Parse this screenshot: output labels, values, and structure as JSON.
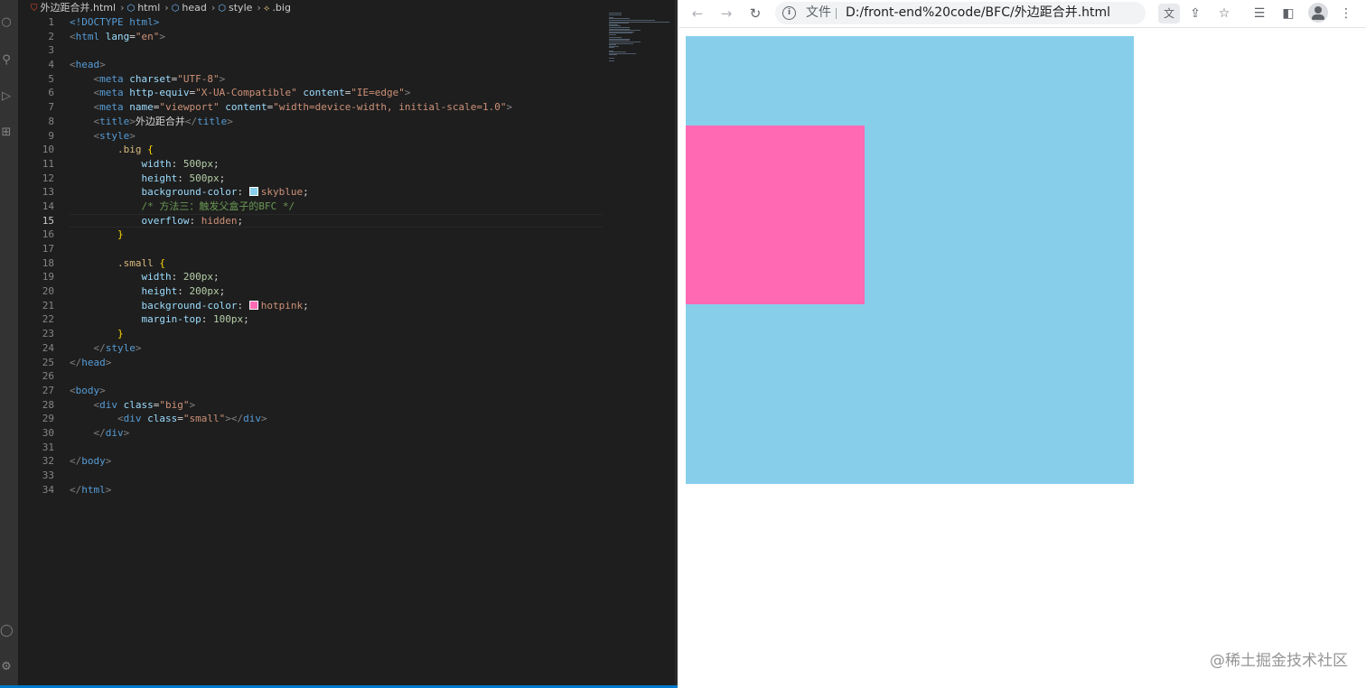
{
  "editor": {
    "breadcrumb": [
      {
        "label": "外边距合并.html",
        "icon": "html5-file-icon",
        "glyph": "⛉"
      },
      {
        "label": "html",
        "icon": "cube-icon",
        "glyph": "⬡"
      },
      {
        "label": "head",
        "icon": "cube-icon",
        "glyph": "⬡"
      },
      {
        "label": "style",
        "icon": "cube-icon",
        "glyph": "⬡"
      },
      {
        "label": ".big",
        "icon": "selector-icon",
        "glyph": "⟡"
      }
    ],
    "active_line": 15,
    "lines": [
      [
        [
          "t-doctype",
          "<!DOCTYPE html>"
        ]
      ],
      [
        [
          "t-bracket",
          "<"
        ],
        [
          "t-tag",
          "html"
        ],
        [
          "t-text",
          " "
        ],
        [
          "t-attr",
          "lang"
        ],
        [
          "t-text",
          "="
        ],
        [
          "t-str",
          "\"en\""
        ],
        [
          "t-bracket",
          ">"
        ]
      ],
      [],
      [
        [
          "t-bracket",
          "<"
        ],
        [
          "t-tag",
          "head"
        ],
        [
          "t-bracket",
          ">"
        ]
      ],
      [
        [
          "t-text",
          "    "
        ],
        [
          "t-bracket",
          "<"
        ],
        [
          "t-tag",
          "meta"
        ],
        [
          "t-text",
          " "
        ],
        [
          "t-attr",
          "charset"
        ],
        [
          "t-text",
          "="
        ],
        [
          "t-str",
          "\"UTF-8\""
        ],
        [
          "t-bracket",
          ">"
        ]
      ],
      [
        [
          "t-text",
          "    "
        ],
        [
          "t-bracket",
          "<"
        ],
        [
          "t-tag",
          "meta"
        ],
        [
          "t-text",
          " "
        ],
        [
          "t-attr",
          "http-equiv"
        ],
        [
          "t-text",
          "="
        ],
        [
          "t-str",
          "\"X-UA-Compatible\""
        ],
        [
          "t-text",
          " "
        ],
        [
          "t-attr",
          "content"
        ],
        [
          "t-text",
          "="
        ],
        [
          "t-str",
          "\"IE=edge\""
        ],
        [
          "t-bracket",
          ">"
        ]
      ],
      [
        [
          "t-text",
          "    "
        ],
        [
          "t-bracket",
          "<"
        ],
        [
          "t-tag",
          "meta"
        ],
        [
          "t-text",
          " "
        ],
        [
          "t-attr",
          "name"
        ],
        [
          "t-text",
          "="
        ],
        [
          "t-str",
          "\"viewport\""
        ],
        [
          "t-text",
          " "
        ],
        [
          "t-attr",
          "content"
        ],
        [
          "t-text",
          "="
        ],
        [
          "t-str",
          "\"width=device-width, initial-scale=1.0\""
        ],
        [
          "t-bracket",
          ">"
        ]
      ],
      [
        [
          "t-text",
          "    "
        ],
        [
          "t-bracket",
          "<"
        ],
        [
          "t-tag",
          "title"
        ],
        [
          "t-bracket",
          ">"
        ],
        [
          "t-text",
          "外边距合并"
        ],
        [
          "t-bracket",
          "</"
        ],
        [
          "t-tag",
          "title"
        ],
        [
          "t-bracket",
          ">"
        ]
      ],
      [
        [
          "t-text",
          "    "
        ],
        [
          "t-bracket",
          "<"
        ],
        [
          "t-tag",
          "style"
        ],
        [
          "t-bracket",
          ">"
        ]
      ],
      [
        [
          "t-text",
          "        "
        ],
        [
          "t-sel",
          ".big"
        ],
        [
          "t-text",
          " "
        ],
        [
          "t-brace",
          "{"
        ]
      ],
      [
        [
          "t-text",
          "            "
        ],
        [
          "t-prop",
          "width"
        ],
        [
          "t-text",
          ": "
        ],
        [
          "t-num",
          "500px"
        ],
        [
          "t-text",
          ";"
        ]
      ],
      [
        [
          "t-text",
          "            "
        ],
        [
          "t-prop",
          "height"
        ],
        [
          "t-text",
          ": "
        ],
        [
          "t-num",
          "500px"
        ],
        [
          "t-text",
          ";"
        ]
      ],
      [
        [
          "t-text",
          "            "
        ],
        [
          "t-prop",
          "background-color"
        ],
        [
          "t-text",
          ": "
        ],
        [
          "swatch",
          "#87ceeb"
        ],
        [
          "t-val",
          "skyblue"
        ],
        [
          "t-text",
          ";"
        ]
      ],
      [
        [
          "t-text",
          "            "
        ],
        [
          "t-comment",
          "/* 方法三：触发父盒子的BFC */"
        ]
      ],
      [
        [
          "t-text",
          "            "
        ],
        [
          "t-prop",
          "overflow"
        ],
        [
          "t-text",
          ": "
        ],
        [
          "t-val",
          "hidden"
        ],
        [
          "t-text",
          ";"
        ]
      ],
      [
        [
          "t-text",
          "        "
        ],
        [
          "t-brace",
          "}"
        ]
      ],
      [],
      [
        [
          "t-text",
          "        "
        ],
        [
          "t-sel",
          ".small"
        ],
        [
          "t-text",
          " "
        ],
        [
          "t-brace",
          "{"
        ]
      ],
      [
        [
          "t-text",
          "            "
        ],
        [
          "t-prop",
          "width"
        ],
        [
          "t-text",
          ": "
        ],
        [
          "t-num",
          "200px"
        ],
        [
          "t-text",
          ";"
        ]
      ],
      [
        [
          "t-text",
          "            "
        ],
        [
          "t-prop",
          "height"
        ],
        [
          "t-text",
          ": "
        ],
        [
          "t-num",
          "200px"
        ],
        [
          "t-text",
          ";"
        ]
      ],
      [
        [
          "t-text",
          "            "
        ],
        [
          "t-prop",
          "background-color"
        ],
        [
          "t-text",
          ": "
        ],
        [
          "swatch",
          "#ff69b4"
        ],
        [
          "t-val",
          "hotpink"
        ],
        [
          "t-text",
          ";"
        ]
      ],
      [
        [
          "t-text",
          "            "
        ],
        [
          "t-prop",
          "margin-top"
        ],
        [
          "t-text",
          ": "
        ],
        [
          "t-num",
          "100px"
        ],
        [
          "t-text",
          ";"
        ]
      ],
      [
        [
          "t-text",
          "        "
        ],
        [
          "t-brace",
          "}"
        ]
      ],
      [
        [
          "t-text",
          "    "
        ],
        [
          "t-bracket",
          "</"
        ],
        [
          "t-tag",
          "style"
        ],
        [
          "t-bracket",
          ">"
        ]
      ],
      [
        [
          "t-bracket",
          "</"
        ],
        [
          "t-tag",
          "head"
        ],
        [
          "t-bracket",
          ">"
        ]
      ],
      [],
      [
        [
          "t-bracket",
          "<"
        ],
        [
          "t-tag",
          "body"
        ],
        [
          "t-bracket",
          ">"
        ]
      ],
      [
        [
          "t-text",
          "    "
        ],
        [
          "t-bracket",
          "<"
        ],
        [
          "t-tag",
          "div"
        ],
        [
          "t-text",
          " "
        ],
        [
          "t-attr",
          "class"
        ],
        [
          "t-text",
          "="
        ],
        [
          "t-str",
          "\"big\""
        ],
        [
          "t-bracket",
          ">"
        ]
      ],
      [
        [
          "t-text",
          "        "
        ],
        [
          "t-bracket",
          "<"
        ],
        [
          "t-tag",
          "div"
        ],
        [
          "t-text",
          " "
        ],
        [
          "t-attr",
          "class"
        ],
        [
          "t-text",
          "="
        ],
        [
          "t-str",
          "\"small\""
        ],
        [
          "t-bracket",
          "></"
        ],
        [
          "t-tag",
          "div"
        ],
        [
          "t-bracket",
          ">"
        ]
      ],
      [
        [
          "t-text",
          "    "
        ],
        [
          "t-bracket",
          "</"
        ],
        [
          "t-tag",
          "div"
        ],
        [
          "t-bracket",
          ">"
        ]
      ],
      [],
      [
        [
          "t-bracket",
          "</"
        ],
        [
          "t-tag",
          "body"
        ],
        [
          "t-bracket",
          ">"
        ]
      ],
      [],
      [
        [
          "t-bracket",
          "</"
        ],
        [
          "t-tag",
          "html"
        ],
        [
          "t-bracket",
          ">"
        ]
      ]
    ]
  },
  "browser": {
    "scheme_label": "文件",
    "url": "D:/front-end%20code/BFC/外边距合并.html",
    "big_box_color": "#87ceeb",
    "small_box_color": "#ff69b4",
    "watermark": "@稀土掘金技术社区"
  }
}
